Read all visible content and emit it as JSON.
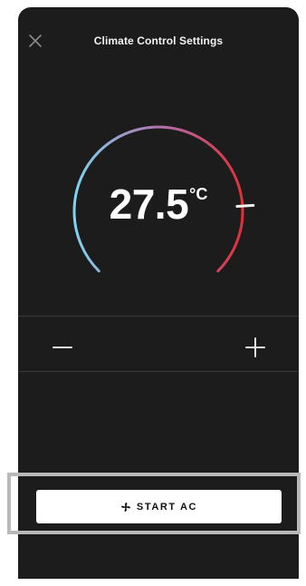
{
  "header": {
    "title": "Climate Control Settings",
    "close_icon": "close-icon"
  },
  "thermostat": {
    "temperature": "27.5",
    "unit": "°C",
    "level_fraction": 0.82,
    "gradient_colors": [
      "#7fd3f0",
      "#b56aa6",
      "#e0303a"
    ],
    "track_color": "#2a2a2a"
  },
  "stepper": {
    "decrease_icon": "minus-icon",
    "increase_icon": "plus-icon"
  },
  "action": {
    "start_label": "START AC",
    "icon": "fan-icon"
  }
}
